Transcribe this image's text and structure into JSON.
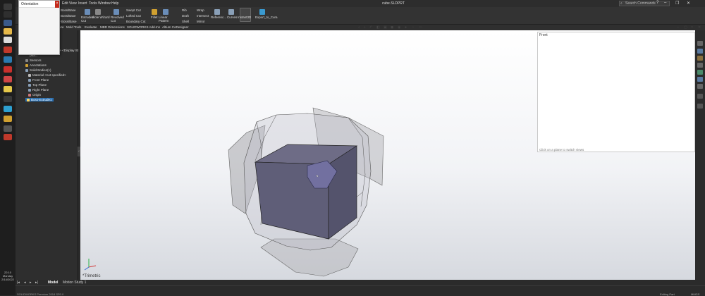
{
  "app": {
    "document_title": "cube.SLDPRT",
    "menus": [
      "Edit",
      "View",
      "Insert",
      "Tools",
      "Window",
      "Help"
    ],
    "search_placeholder": "Search Commands"
  },
  "orientation_popup": {
    "title": "Orientation",
    "close": "×"
  },
  "ribbon": {
    "partial_left": [
      "Boss/Base",
      "Boss/Base",
      "ry Boss/Base"
    ],
    "extruded_cut": "Extruded Cut",
    "hole_wizard": "Hole Wizard",
    "revolved_cut": "Revolved Cut",
    "swept_cut": "Swept Cut",
    "lofted_cut": "Lofted Cut",
    "boundary_cut": "Boundary Cut",
    "fillet": "Fillet",
    "linear_pattern": "Linear Pattern",
    "rib": "Rib",
    "draft": "Draft",
    "shell": "Shell",
    "wrap": "Wrap",
    "intersect": "Intersect",
    "mirror": "Mirror",
    "reference": "Referenc...",
    "curves": "Curves",
    "instant3d": "Instant3D",
    "export_cura": "Export_to_Cura"
  },
  "tabs": [
    "ure",
    "Mold Tools",
    "Evaluate",
    "MBD Dimensions",
    "SOLIDWORKS Add-Ins",
    "Altium CoDesigner"
  ],
  "tree": {
    "top_partial": [
      "(Ma...",
      "s> <Display St"
    ],
    "items": [
      "Sensors",
      "Annotations",
      "Solid Bodies(1)",
      "Material <not specified>",
      "Front Plane",
      "Top Plane",
      "Right Plane",
      "Origin",
      "Boss-Extrude1"
    ],
    "selected": "Boss-Extrude1"
  },
  "front_view": {
    "title": "Front",
    "hint": "Click on a plane to switch views"
  },
  "viewport": {
    "view_name": "*Trimetric"
  },
  "bottom_tabs": [
    "Model",
    "Motion Study 1"
  ],
  "status": {
    "left": "SOLIDWORKS Premium 2018 SP0.0",
    "editing": "Editing Part",
    "units": "MMGS"
  },
  "clock": {
    "time": "22:10",
    "day": "Monday",
    "date": "2/14/2022"
  },
  "colors": {
    "accent": "#2a6fb0",
    "cube": "#5f5e78",
    "viewport_top": "#ffffff",
    "chrome": "#2d2d2d"
  }
}
